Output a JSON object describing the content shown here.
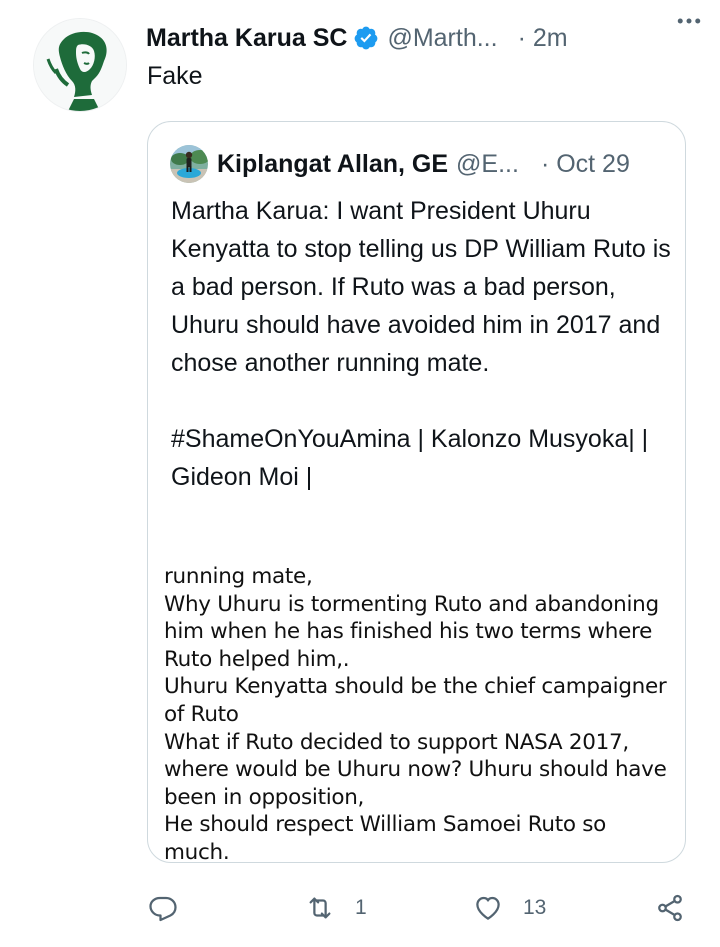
{
  "tweet": {
    "author_name": "Martha Karua SC",
    "author_handle": "@Marth...",
    "time": "· 2m",
    "text": "Fake",
    "avatar": "profile-portrait-green",
    "verified_icon": "verified-badge-icon",
    "verified_color": "#1d9bf0",
    "more_icon": "more-horizontal-icon"
  },
  "quote": {
    "author_name": "Kiplangat Allan, GE",
    "author_handle": "@E...",
    "time": "· Oct 29",
    "avatar": "profile-photo",
    "paragraph_1": "Martha Karua: I want President Uhuru Kenyatta to stop telling us DP William Ruto is a bad person. If Ruto was a bad person, Uhuru should have avoided him in 2017 and chose another running mate.",
    "paragraph_2": "#ShameOnYouAmina | Kalonzo Musyoka| | Gideon Moi |",
    "image_lines": [
      "running mate,",
      "Why Uhuru is tormenting Ruto and abandoning",
      "him when he has finished his two terms where",
      "Ruto helped him,.",
      "Uhuru Kenyatta should be the chief campaigner",
      "of Ruto",
      "What if Ruto decided to support NASA 2017,",
      "where would be Uhuru now? Uhuru should have",
      "been in opposition,",
      "He should respect William Samoei Ruto so",
      "much."
    ]
  },
  "actions": {
    "reply_icon": "reply-icon",
    "retweet_icon": "retweet-icon",
    "retweet_count": "1",
    "like_icon": "heart-icon",
    "like_count": "13",
    "share_icon": "share-icon"
  },
  "colors": {
    "text_primary": "#0f1419",
    "text_secondary": "#536471",
    "border": "#cfd9de",
    "avatar_green": "#1e6b3a"
  }
}
